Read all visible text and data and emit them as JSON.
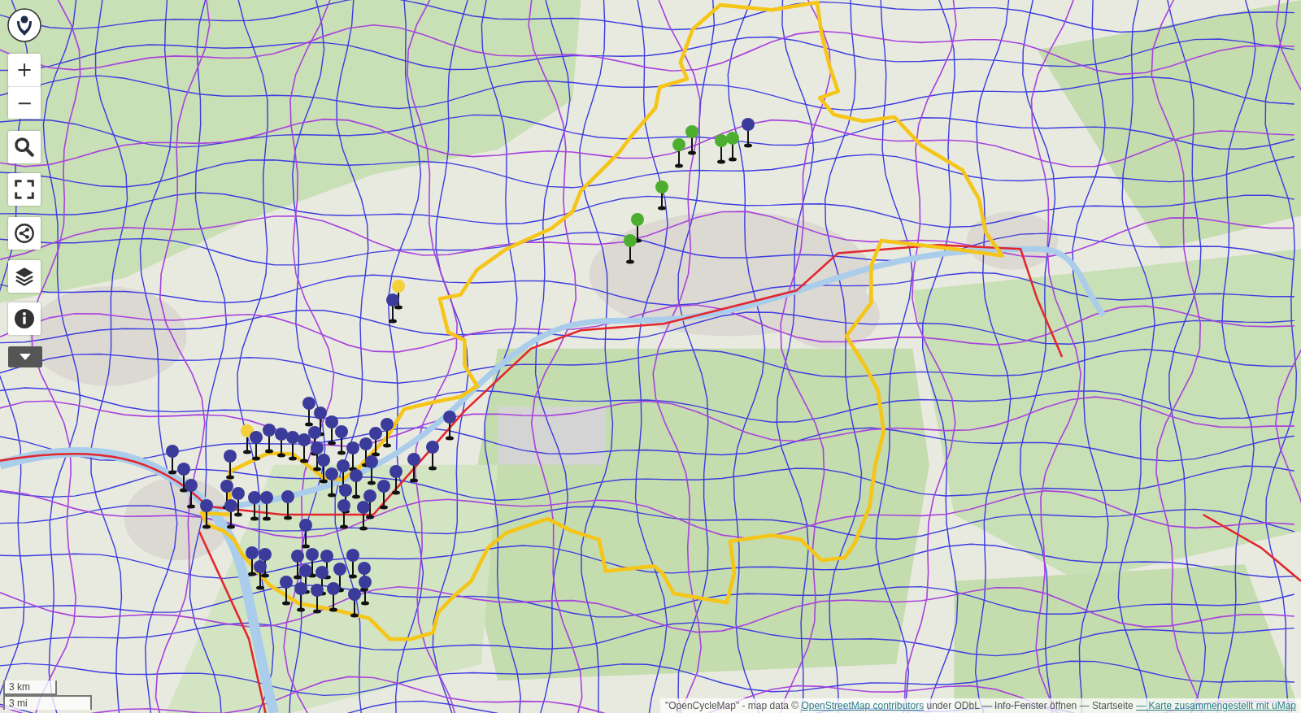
{
  "controls": {
    "zoom_in": "+",
    "zoom_out": "−"
  },
  "markers": [
    {
      "color": "#3b3b9b"
    },
    {
      "color": "#3b3b9b"
    },
    {
      "color": "#3b3b9b"
    },
    {
      "color": "#3b3b9b"
    },
    {
      "color": "#3b3b9b"
    },
    {
      "color": "#3b3b9b"
    },
    {
      "color": "#3b3b9b"
    },
    {
      "color": "#3b3b9b"
    },
    {
      "color": "#f4d03a"
    },
    {
      "color": "#3b3b9b"
    },
    {
      "color": "#3b3b9b"
    },
    {
      "color": "#3b3b9b"
    },
    {
      "color": "#3b3b9b"
    },
    {
      "color": "#3b3b9b"
    },
    {
      "color": "#3b3b9b"
    },
    {
      "color": "#3b3b9b"
    },
    {
      "color": "#3b3b9b"
    },
    {
      "color": "#3b3b9b"
    },
    {
      "color": "#3b3b9b"
    },
    {
      "color": "#3b3b9b"
    },
    {
      "color": "#3b3b9b"
    },
    {
      "color": "#3b3b9b"
    },
    {
      "color": "#3b3b9b"
    },
    {
      "color": "#3b3b9b"
    },
    {
      "color": "#3b3b9b"
    },
    {
      "color": "#3b3b9b"
    },
    {
      "color": "#3b3b9b"
    },
    {
      "color": "#3b3b9b"
    },
    {
      "color": "#3b3b9b"
    },
    {
      "color": "#3b3b9b"
    },
    {
      "color": "#3b3b9b"
    },
    {
      "color": "#3b3b9b"
    },
    {
      "color": "#3b3b9b"
    },
    {
      "color": "#3b3b9b"
    },
    {
      "color": "#3b3b9b"
    },
    {
      "color": "#3b3b9b"
    },
    {
      "color": "#3b3b9b"
    },
    {
      "color": "#3b3b9b"
    },
    {
      "color": "#3b3b9b"
    },
    {
      "color": "#3b3b9b"
    },
    {
      "color": "#3b3b9b"
    },
    {
      "color": "#3b3b9b"
    },
    {
      "color": "#3b3b9b"
    },
    {
      "color": "#3b3b9b"
    },
    {
      "color": "#3b3b9b"
    },
    {
      "color": "#3b3b9b"
    },
    {
      "color": "#3b3b9b"
    },
    {
      "color": "#3b3b9b"
    },
    {
      "color": "#3b3b9b"
    },
    {
      "color": "#3b3b9b"
    },
    {
      "color": "#3b3b9b"
    },
    {
      "color": "#3b3b9b"
    },
    {
      "color": "#3b3b9b"
    },
    {
      "color": "#3b3b9b"
    },
    {
      "color": "#3b3b9b"
    },
    {
      "color": "#3b3b9b"
    },
    {
      "color": "#3b3b9b"
    },
    {
      "color": "#3b3b9b"
    },
    {
      "color": "#3b3b9b"
    },
    {
      "color": "#f4d03a"
    },
    {
      "color": "#3b3b9b"
    },
    {
      "color": "#4cae2e"
    },
    {
      "color": "#4cae2e"
    },
    {
      "color": "#4cae2e"
    },
    {
      "color": "#4cae2e"
    },
    {
      "color": "#4cae2e"
    },
    {
      "color": "#4cae2e"
    },
    {
      "color": "#4cae2e"
    },
    {
      "color": "#3b3b9b"
    }
  ],
  "scale": {
    "metric": "3 km",
    "imperial": "3 mi"
  },
  "attribution": [
    {
      "kind": "text",
      "text": "\"OpenCycleMap\" - map data © "
    },
    {
      "kind": "link",
      "text": "OpenStreetMap contributors"
    },
    {
      "kind": "text",
      "text": " under ODbL — "
    },
    {
      "kind": "action",
      "text": "Info-Fenster öffnen"
    },
    {
      "kind": "text",
      "text": " — "
    },
    {
      "kind": "action",
      "text": "Startseite"
    },
    {
      "kind": "link",
      "text": "— Karte zusammengestellt mit uMap"
    }
  ]
}
